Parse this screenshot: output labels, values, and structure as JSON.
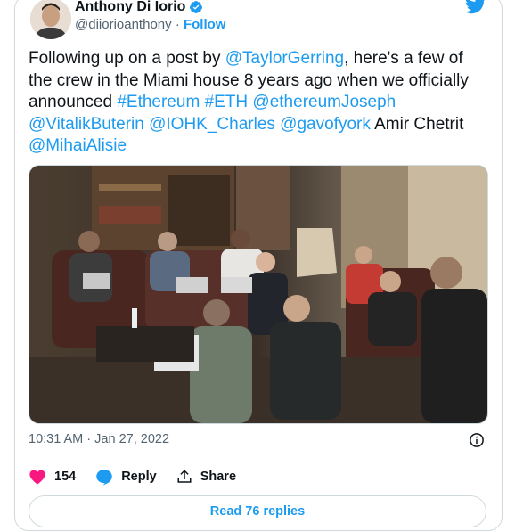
{
  "author": {
    "name": "Anthony Di Iorio",
    "handle": "@diiorioanthony",
    "separator": "·",
    "follow_label": "Follow"
  },
  "tweet": {
    "segments": [
      {
        "text": "Following up on a post by ",
        "link": false
      },
      {
        "text": "@TaylorGerring",
        "link": true
      },
      {
        "text": ", here's a few of the crew in the Miami house 8 years ago when we officially announced ",
        "link": false
      },
      {
        "text": "#Ethereum",
        "link": true
      },
      {
        "text": " ",
        "link": false
      },
      {
        "text": "#ETH",
        "link": true
      },
      {
        "text": " ",
        "link": false
      },
      {
        "text": "@ethereumJoseph",
        "link": true
      },
      {
        "text": " ",
        "link": false
      },
      {
        "text": "@VitalikButerin",
        "link": true
      },
      {
        "text": " ",
        "link": false
      },
      {
        "text": "@IOHK_Charles",
        "link": true
      },
      {
        "text": " ",
        "link": false
      },
      {
        "text": "@gavofyork",
        "link": true
      },
      {
        "text": " Amir Chetrit ",
        "link": false
      },
      {
        "text": "@MihaiAlisie",
        "link": true
      }
    ]
  },
  "meta": {
    "time": "10:31 AM",
    "separator": "·",
    "date": "Jan 27, 2022"
  },
  "actions": {
    "like_count": "154",
    "reply_label": "Reply",
    "share_label": "Share"
  },
  "replies_button": "Read 76 replies",
  "colors": {
    "link": "#1d9bf0",
    "like": "#f91880",
    "reply": "#1d9bf0",
    "muted": "#536471"
  }
}
